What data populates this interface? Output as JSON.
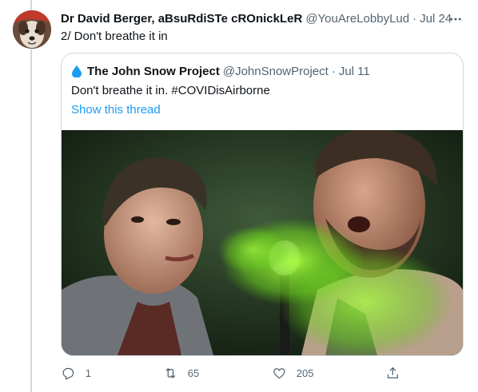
{
  "tweet": {
    "author_name": "Dr David Berger, aBsuRdiSTe cROnickLeR",
    "handle": "@YouAreLobbyLud",
    "separator": "·",
    "date": "Jul 24",
    "text": "2/ Don't breathe it in"
  },
  "quoted": {
    "author_name": "The John Snow Project",
    "handle": "@JohnSnowProject",
    "separator": "·",
    "date": "Jul 11",
    "text": "Don't breathe it in. #COVIDisAirborne",
    "show_thread": "Show this thread",
    "media_icon": "water-drop-icon"
  },
  "actions": {
    "reply_count": "1",
    "retweet_count": "65",
    "like_count": "205",
    "reply_icon": "reply-icon",
    "retweet_icon": "retweet-icon",
    "like_icon": "heart-icon",
    "share_icon": "share-icon"
  },
  "colors": {
    "text": "#0f1419",
    "secondary": "#536471",
    "link": "#1d9bf0",
    "border": "#cfd9de",
    "smoke": "#7bdc2a"
  }
}
